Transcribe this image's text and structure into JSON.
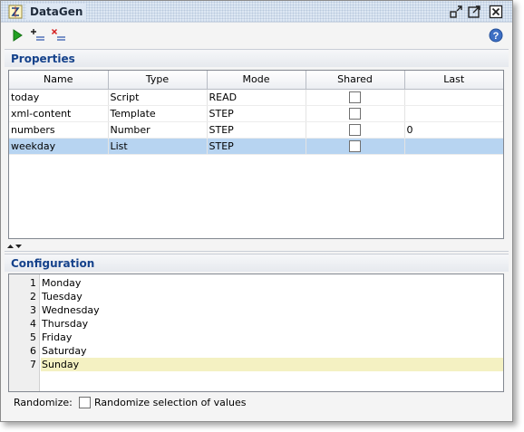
{
  "window": {
    "title": "DataGen",
    "icons": {
      "app": "datagen-icon",
      "undock": "undock-icon",
      "maximize": "maximize-icon",
      "close": "close-icon"
    }
  },
  "toolbar": {
    "run_icon": "play-icon",
    "add_icon": "add-property-icon",
    "remove_icon": "remove-property-icon",
    "help_icon": "help-icon"
  },
  "properties": {
    "header": "Properties",
    "columns": [
      "Name",
      "Type",
      "Mode",
      "Shared",
      "Last"
    ],
    "rows": [
      {
        "name": "today",
        "type": "Script",
        "mode": "READ",
        "shared": false,
        "last": ""
      },
      {
        "name": "xml-content",
        "type": "Template",
        "mode": "STEP",
        "shared": false,
        "last": ""
      },
      {
        "name": "numbers",
        "type": "Number",
        "mode": "STEP",
        "shared": false,
        "last": "0"
      },
      {
        "name": "weekday",
        "type": "List",
        "mode": "STEP",
        "shared": false,
        "last": ""
      }
    ],
    "selected_row": 3
  },
  "configuration": {
    "header": "Configuration",
    "lines": [
      {
        "no": "1",
        "text": "Monday"
      },
      {
        "no": "2",
        "text": "Tuesday"
      },
      {
        "no": "3",
        "text": "Wednesday"
      },
      {
        "no": "4",
        "text": "Thursday"
      },
      {
        "no": "5",
        "text": "Friday"
      },
      {
        "no": "6",
        "text": "Saturday"
      },
      {
        "no": "7",
        "text": "Sunday"
      }
    ],
    "current_line": 7,
    "randomize_label": "Randomize:",
    "randomize_checkbox_label": "Randomize selection of values",
    "randomize_checked": false
  },
  "colors": {
    "header_text": "#15428b",
    "selection": "#b7d4f1",
    "current_line": "#f4f1c2",
    "run_green": "#22a022"
  }
}
